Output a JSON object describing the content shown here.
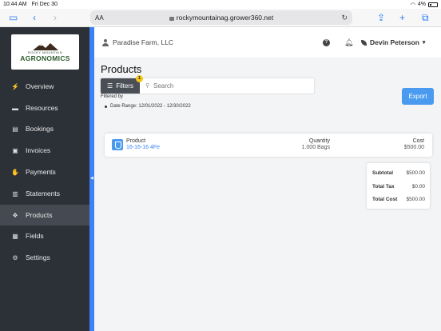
{
  "status": {
    "time": "10:44 AM",
    "date": "Fri Dec 30",
    "battery": "4%"
  },
  "browser": {
    "aa_label": "AA",
    "url": "rockymountainag.grower360.net"
  },
  "logo": {
    "line1": "ROCKY MOUNTAIN",
    "line2": "AGRONOMICS"
  },
  "sidebar": {
    "items": [
      {
        "label": "Overview",
        "icon": "bolt-icon"
      },
      {
        "label": "Resources",
        "icon": "folder-icon"
      },
      {
        "label": "Bookings",
        "icon": "book-icon"
      },
      {
        "label": "Invoices",
        "icon": "invoice-icon"
      },
      {
        "label": "Payments",
        "icon": "payments-icon"
      },
      {
        "label": "Statements",
        "icon": "statements-icon"
      },
      {
        "label": "Products",
        "icon": "products-icon",
        "active": true
      },
      {
        "label": "Fields",
        "icon": "fields-icon"
      },
      {
        "label": "Settings",
        "icon": "gear-icon"
      }
    ]
  },
  "header": {
    "farm": "Paradise Farm, LLC",
    "user": "Devin Peterson"
  },
  "page": {
    "title": "Products",
    "filters_label": "Filters",
    "filters_count": "1",
    "search_placeholder": "Search",
    "export_label": "Export",
    "filtered_by": "Filtered by",
    "date_range": "Date Range: 12/01/2022 - 12/30/2022"
  },
  "product_row": {
    "product_header": "Product",
    "product_name": "16-16-16 4Fe",
    "quantity_header": "Quantity",
    "quantity": "1.000 Bags",
    "cost_header": "Cost",
    "cost": "$500.00"
  },
  "totals": {
    "subtotal_label": "Subtotal",
    "subtotal": "$500.00",
    "tax_label": "Total Tax",
    "tax": "$0.00",
    "total_label": "Total Cost",
    "total": "$500.00"
  },
  "colors": {
    "accent": "#3b82f6",
    "sidebar": "#2c3138",
    "badge": "#f5c518"
  }
}
